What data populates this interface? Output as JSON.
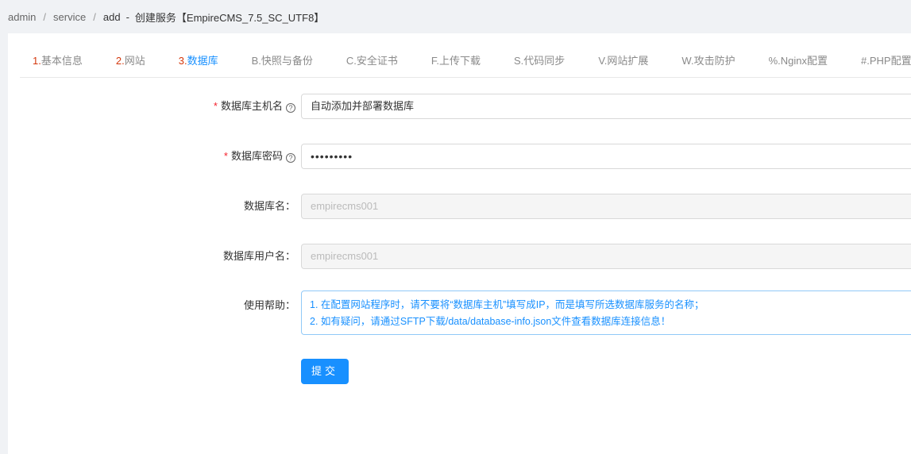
{
  "breadcrumb": {
    "items": [
      "admin",
      "service"
    ],
    "current": "add",
    "title": "创建服务【EmpireCMS_7.5_SC_UTF8】"
  },
  "tabs": [
    {
      "num": "1.",
      "label": "基本信息"
    },
    {
      "num": "2.",
      "label": "网站"
    },
    {
      "num": "3.",
      "label": "数据库"
    },
    {
      "num": "",
      "label": "B.快照与备份"
    },
    {
      "num": "",
      "label": "C.安全证书"
    },
    {
      "num": "",
      "label": "F.上传下载"
    },
    {
      "num": "",
      "label": "S.代码同步"
    },
    {
      "num": "",
      "label": "V.网站扩展"
    },
    {
      "num": "",
      "label": "W.攻击防护"
    },
    {
      "num": "",
      "label": "%.Nginx配置"
    },
    {
      "num": "",
      "label": "#.PHP配置"
    },
    {
      "num": "",
      "label": "*"
    }
  ],
  "form": {
    "db_host": {
      "label": "数据库主机名",
      "value": "自动添加并部署数据库"
    },
    "db_password": {
      "label": "数据库密码",
      "value": "•••••••••"
    },
    "db_name": {
      "label": "数据库名：",
      "value": "empirecms001"
    },
    "db_user": {
      "label": "数据库用户名：",
      "value": "empirecms001"
    },
    "help": {
      "label": "使用帮助：",
      "line1": "1. 在配置网站程序时，请不要将“数据库主机”填写成IP，而是填写所选数据库服务的名称；",
      "line2": "2. 如有疑问，请通过SFTP下载/data/database-info.json文件查看数据库连接信息！"
    },
    "submit_label": "提交"
  }
}
